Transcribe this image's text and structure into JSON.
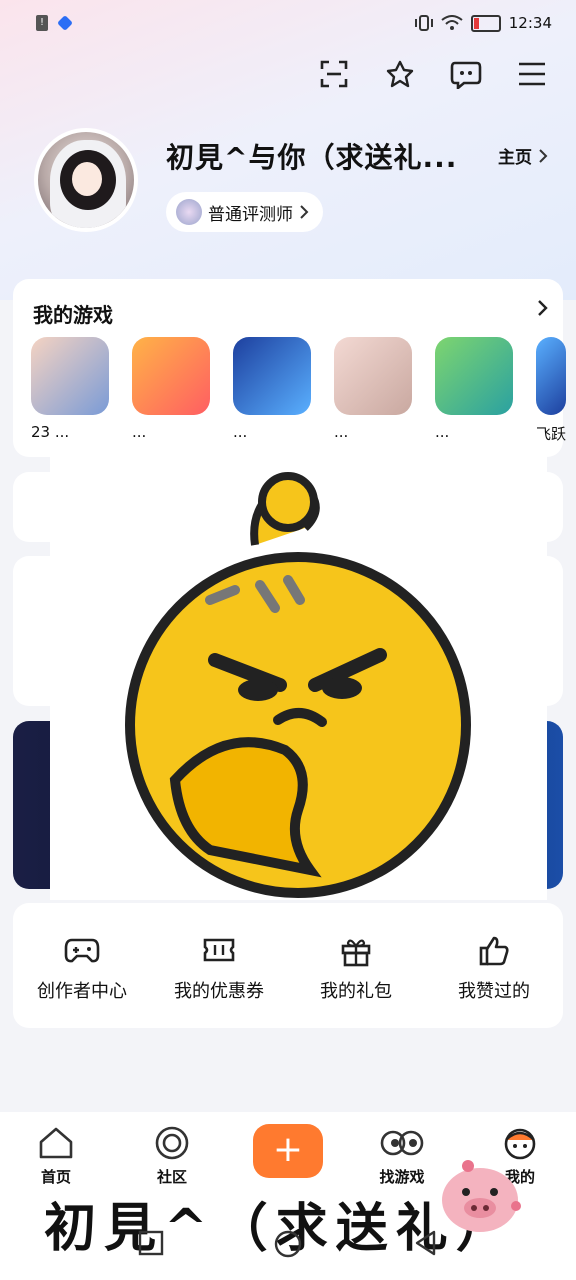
{
  "status_bar": {
    "time": "12:34"
  },
  "profile": {
    "username": "初見^与你（求送礼...",
    "home_link": "主页",
    "badge": "普通评测师"
  },
  "my_games": {
    "title": "我的游戏",
    "games": [
      {
        "name": "23 ...",
        "color_a": "#f5d3c2",
        "color_b": "#7a9bd6"
      },
      {
        "name": "...",
        "color_a": "#ffb347",
        "color_b": "#ff5e62"
      },
      {
        "name": "...",
        "color_a": "#1d3f9e",
        "color_b": "#5ab0ff"
      },
      {
        "name": "...",
        "color_a": "#f3d9d3",
        "color_b": "#c9a8a0"
      },
      {
        "name": "...",
        "color_a": "#7ed56f",
        "color_b": "#2aa1a1"
      },
      {
        "name": "飞跃",
        "color_a": "#5ab0ff",
        "color_b": "#1d3f9e"
      }
    ]
  },
  "tools": [
    {
      "label": "创作者中心",
      "icon": "gamepad-icon"
    },
    {
      "label": "我的优惠券",
      "icon": "ticket-icon"
    },
    {
      "label": "我的礼包",
      "icon": "gift-icon"
    },
    {
      "label": "我赞过的",
      "icon": "thumbs-up-icon"
    }
  ],
  "bottom_nav": {
    "home": "首页",
    "community": "社区",
    "plus": "+",
    "find_games": "找游戏",
    "mine": "我的"
  },
  "watermark": "初見^（求送礼）",
  "colors": {
    "accent": "#ff7a2f",
    "emoji_yellow": "#f6c51b"
  }
}
